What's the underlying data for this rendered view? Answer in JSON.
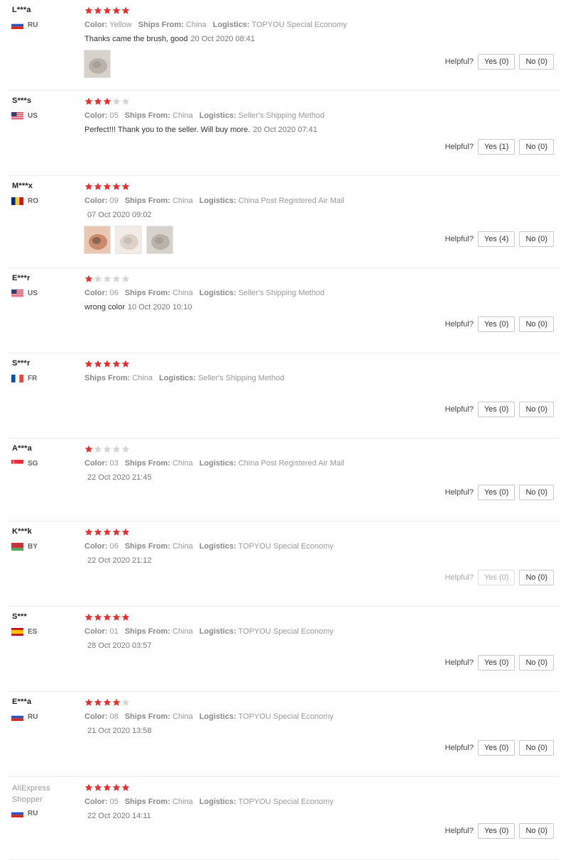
{
  "labels": {
    "color": "Color:",
    "ships_from": "Ships From:",
    "logistics": "Logistics:",
    "helpful": "Helpful?"
  },
  "colors": {
    "star_on": "#e62e2e",
    "star_off": "#d5d5d5"
  },
  "reviews": [
    {
      "user": "L***a",
      "country": "RU",
      "flag": "ru",
      "stars": 5,
      "color": "Yellow",
      "ships_from": "China",
      "logistics": "TOPYOU Special Economy",
      "comment": "Thanks came the brush, good",
      "date": "20 Oct 2020 08:41",
      "photos": 1,
      "yes": "Yes (0)",
      "no": "No (0)"
    },
    {
      "user": "S***s",
      "country": "US",
      "flag": "us",
      "stars": 3,
      "color": "05",
      "ships_from": "China",
      "logistics": "Seller's Shipping Method",
      "comment": "Perfect!!! Thank you to the seller. Will buy more.",
      "date": "20 Oct 2020 07:41",
      "photos": 0,
      "yes": "Yes (1)",
      "no": "No (0)"
    },
    {
      "user": "M***x",
      "country": "RO",
      "flag": "ro",
      "stars": 5,
      "color": "09",
      "ships_from": "China",
      "logistics": "China Post Registered Air Mail",
      "comment": "",
      "date": "07 Oct 2020 09:02",
      "photos": 3,
      "yes": "Yes (4)",
      "no": "No (0)"
    },
    {
      "user": "E***r",
      "country": "US",
      "flag": "us",
      "stars": 1,
      "color": "06",
      "ships_from": "China",
      "logistics": "Seller's Shipping Method",
      "comment": "wrong color",
      "date": "10 Oct 2020 10:10",
      "photos": 0,
      "yes": "Yes (0)",
      "no": "No (0)"
    },
    {
      "user": "S***r",
      "country": "FR",
      "flag": "fr",
      "stars": 5,
      "color": "",
      "ships_from": "China",
      "logistics": "Seller's Shipping Method",
      "comment": "",
      "date": "",
      "photos": 0,
      "yes": "Yes (0)",
      "no": "No (0)"
    },
    {
      "user": "A***a",
      "country": "SG",
      "flag": "sg",
      "stars": 1,
      "color": "03",
      "ships_from": "China",
      "logistics": "China Post Registered Air Mail",
      "comment": "",
      "date": "22 Oct 2020 21:45",
      "photos": 0,
      "yes": "Yes (0)",
      "no": "No (0)"
    },
    {
      "user": "K***k",
      "country": "BY",
      "flag": "by",
      "stars": 5,
      "color": "06",
      "ships_from": "China",
      "logistics": "TOPYOU Special Economy",
      "comment": "",
      "date": "22 Oct 2020 21:12",
      "photos": 0,
      "yes": "Yes (0)",
      "no": "No (0)",
      "faded": true
    },
    {
      "user": "S***",
      "country": "ES",
      "flag": "es",
      "stars": 5,
      "color": "01",
      "ships_from": "China",
      "logistics": "TOPYOU Special Economy",
      "comment": "",
      "date": "28 Oct 2020 03:57",
      "photos": 0,
      "yes": "Yes (0)",
      "no": "No (0)"
    },
    {
      "user": "E***a",
      "country": "RU",
      "flag": "ru",
      "stars": 4,
      "color": "08",
      "ships_from": "China",
      "logistics": "TOPYOU Special Economy",
      "comment": "",
      "date": "21 Oct 2020 13:58",
      "photos": 0,
      "yes": "Yes (0)",
      "no": "No (0)"
    },
    {
      "user": "AliExpress Shopper",
      "country": "RU",
      "flag": "ru",
      "stars": 5,
      "color": "05",
      "ships_from": "China",
      "logistics": "TOPYOU Special Economy",
      "comment": "",
      "date": "22 Oct 2020 14:11",
      "photos": 0,
      "yes": "Yes (0)",
      "no": "No (0)"
    }
  ]
}
